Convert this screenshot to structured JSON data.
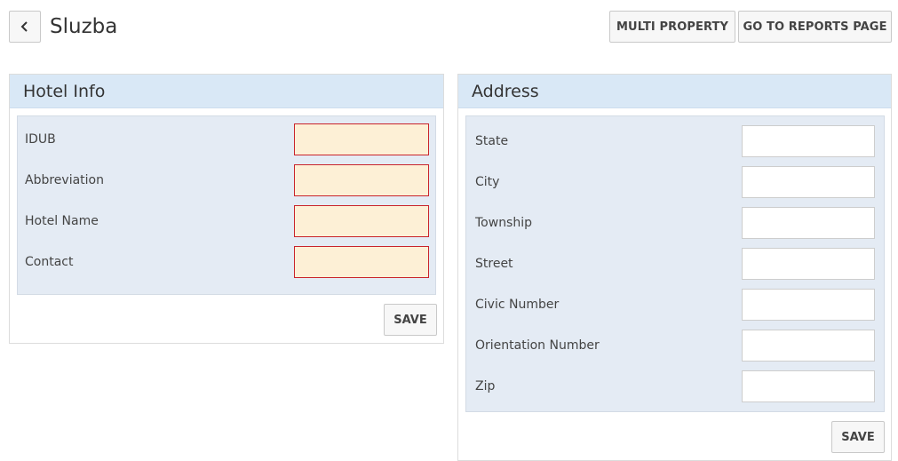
{
  "header": {
    "title": "Sluzba",
    "back_icon": "chevron-left-icon",
    "multi_property_label": "MULTI PROPERTY",
    "reports_label": "GO TO REPORTS PAGE"
  },
  "hotel_info": {
    "title": "Hotel Info",
    "fields": [
      {
        "label": "IDUB",
        "value": ""
      },
      {
        "label": "Abbreviation",
        "value": ""
      },
      {
        "label": "Hotel Name",
        "value": ""
      },
      {
        "label": "Contact",
        "value": ""
      }
    ],
    "save_label": "SAVE"
  },
  "address": {
    "title": "Address",
    "fields": [
      {
        "label": "State",
        "value": ""
      },
      {
        "label": "City",
        "value": ""
      },
      {
        "label": "Township",
        "value": ""
      },
      {
        "label": "Street",
        "value": ""
      },
      {
        "label": "Civic Number",
        "value": ""
      },
      {
        "label": "Orientation Number",
        "value": ""
      },
      {
        "label": "Zip",
        "value": ""
      }
    ],
    "save_label": "SAVE"
  },
  "colors": {
    "panel_header": "#d9e8f6",
    "panel_body": "#e4ebf4",
    "required_fill": "#fdf0d6",
    "required_border": "#c9242b"
  }
}
